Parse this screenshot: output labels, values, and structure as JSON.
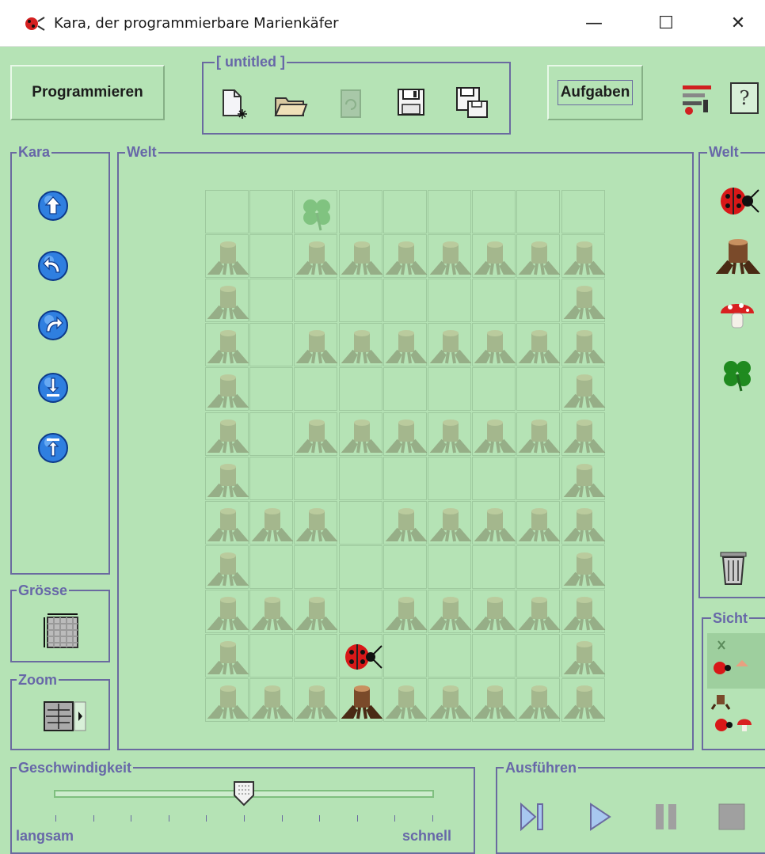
{
  "window": {
    "title": "Kara, der programmierbare Marienkäfer",
    "minimize": "—",
    "maximize": "☐",
    "close": "✕"
  },
  "toolbar": {
    "programmieren_label": "Programmieren",
    "file_group_title": "[ untitled ]",
    "aufgaben_label": "Aufgaben"
  },
  "panels": {
    "kara_title": "Kara",
    "welt_title": "Welt",
    "welt_palette_title": "Welt",
    "groesse_title": "Grösse",
    "zoom_title": "Zoom",
    "sicht_title": "Sicht",
    "speed_title": "Geschwindigkeit",
    "run_title": "Ausführen"
  },
  "speed": {
    "slow_label": "langsam",
    "fast_label": "schnell",
    "value": 0.5
  },
  "world": {
    "cols": 9,
    "rows": 12,
    "legend": "T = tree stump, L = leaf (clover), K = Kara, faded = outside view",
    "cells": [
      "  L       ",
      "T TTTTTTT",
      "T       T",
      "T TTTTTTT",
      "T       T",
      "T TTTTTTT",
      "T       T",
      "TTT TTTTT",
      "T       T",
      "TTT TTTTT",
      "T  K    T",
      "TTTSTTTTT"
    ]
  },
  "colors": {
    "background": "#b5e3b5",
    "border": "#6a6aa0",
    "legend": "#6767a8",
    "button_blue": "#2f7fe0"
  }
}
